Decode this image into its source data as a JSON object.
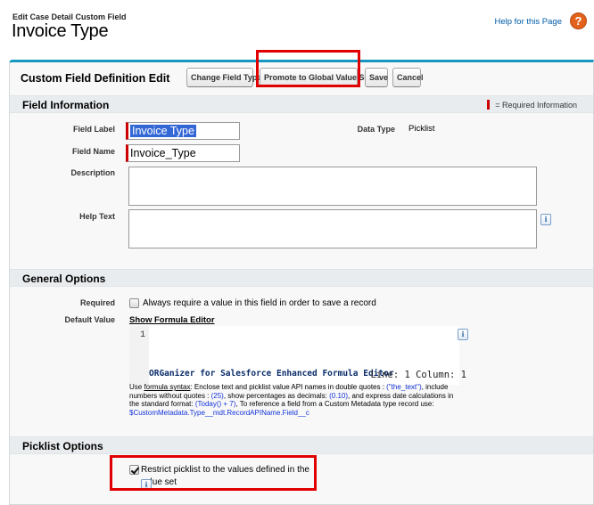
{
  "header": {
    "subtitle": "Edit Case Detail Custom Field",
    "title": "Invoice Type",
    "help_link": "Help for this Page",
    "help_icon": "?"
  },
  "panel": {
    "title": "Custom Field Definition Edit",
    "buttons": {
      "change_field_type": "Change Field Type",
      "promote": "Promote to Global Value Set",
      "save": "Save",
      "cancel": "Cancel"
    }
  },
  "field_information": {
    "title": "Field Information",
    "required_legend": "= Required Information",
    "field_label_label": "Field Label",
    "field_label_value": "Invoice Type",
    "field_name_label": "Field Name",
    "field_name_value": "Invoice_Type",
    "data_type_label": "Data Type",
    "data_type_value": "Picklist",
    "description_label": "Description",
    "description_value": "",
    "help_text_label": "Help Text",
    "help_text_value": "",
    "info_glyph": "i"
  },
  "general_options": {
    "title": "General Options",
    "required_label": "Required",
    "required_checkbox_label": "Always require a value in this field in order to save a record",
    "required_checked": false,
    "default_value_label": "Default Value",
    "show_formula_editor": "Show Formula Editor",
    "editor_line_number": "1",
    "editor_brand": "ORGanizer for Salesforce Enhanced Formula Editor",
    "editor_position": "Line: 1 Column: 1",
    "help": {
      "use": "Use ",
      "formula_syntax": "formula syntax",
      "t1": ": Enclose text and picklist value API names in double quotes : ",
      "ex_text": "(\"the_text\")",
      "t2": ", include numbers without quotes : ",
      "ex_num": "(25)",
      "t3": ", show percentages as decimals: ",
      "ex_pct": "(0.10)",
      "t4": ", and express date calculations in the standard format: ",
      "ex_date": "(Today() + 7)",
      "t5": ", To reference a field from a Custom Metadata type record use: ",
      "ex_meta": "$CustomMetadata.Type__mdt.RecordAPIName.Field__c"
    }
  },
  "picklist_options": {
    "title": "Picklist Options",
    "restrict_label": "Restrict picklist to the values defined in the value set",
    "restrict_checked": true
  },
  "colors": {
    "accent_border": "#1797c0",
    "highlight_box": "#e00000",
    "required_marker": "#cc0000",
    "link": "#015ba7"
  }
}
